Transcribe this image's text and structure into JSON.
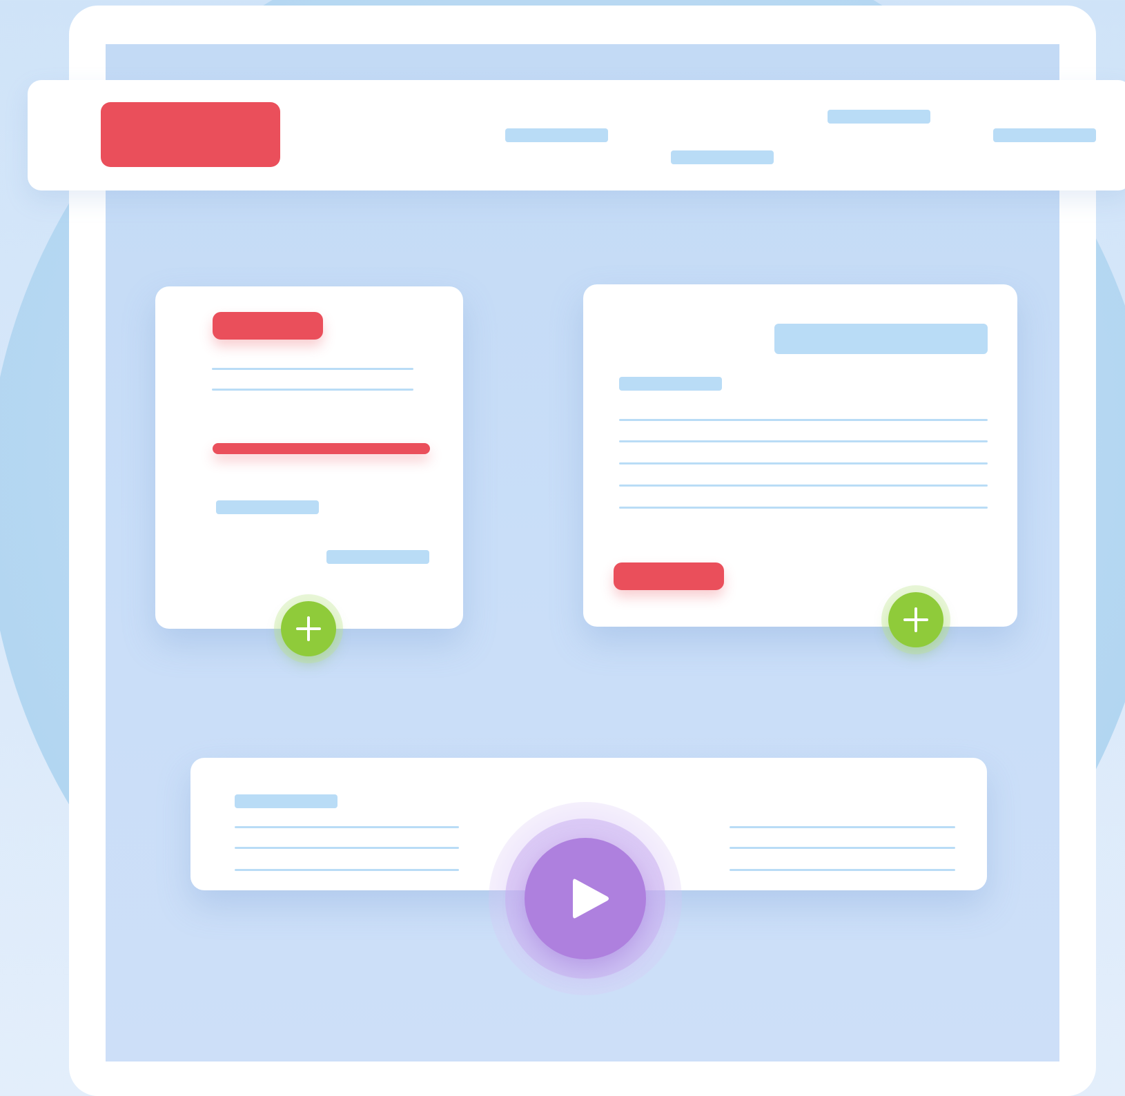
{
  "illustration": {
    "kind": "website-wireframe",
    "colors": {
      "accent_red": "#ea4f5b",
      "placeholder_blue": "#b9dcf6",
      "action_green": "#8fcb3a",
      "play_purple": "#ae80de",
      "screen_blue": "#c6dcf6"
    },
    "icons": {
      "plus": "plus-icon",
      "play": "play-icon"
    }
  }
}
